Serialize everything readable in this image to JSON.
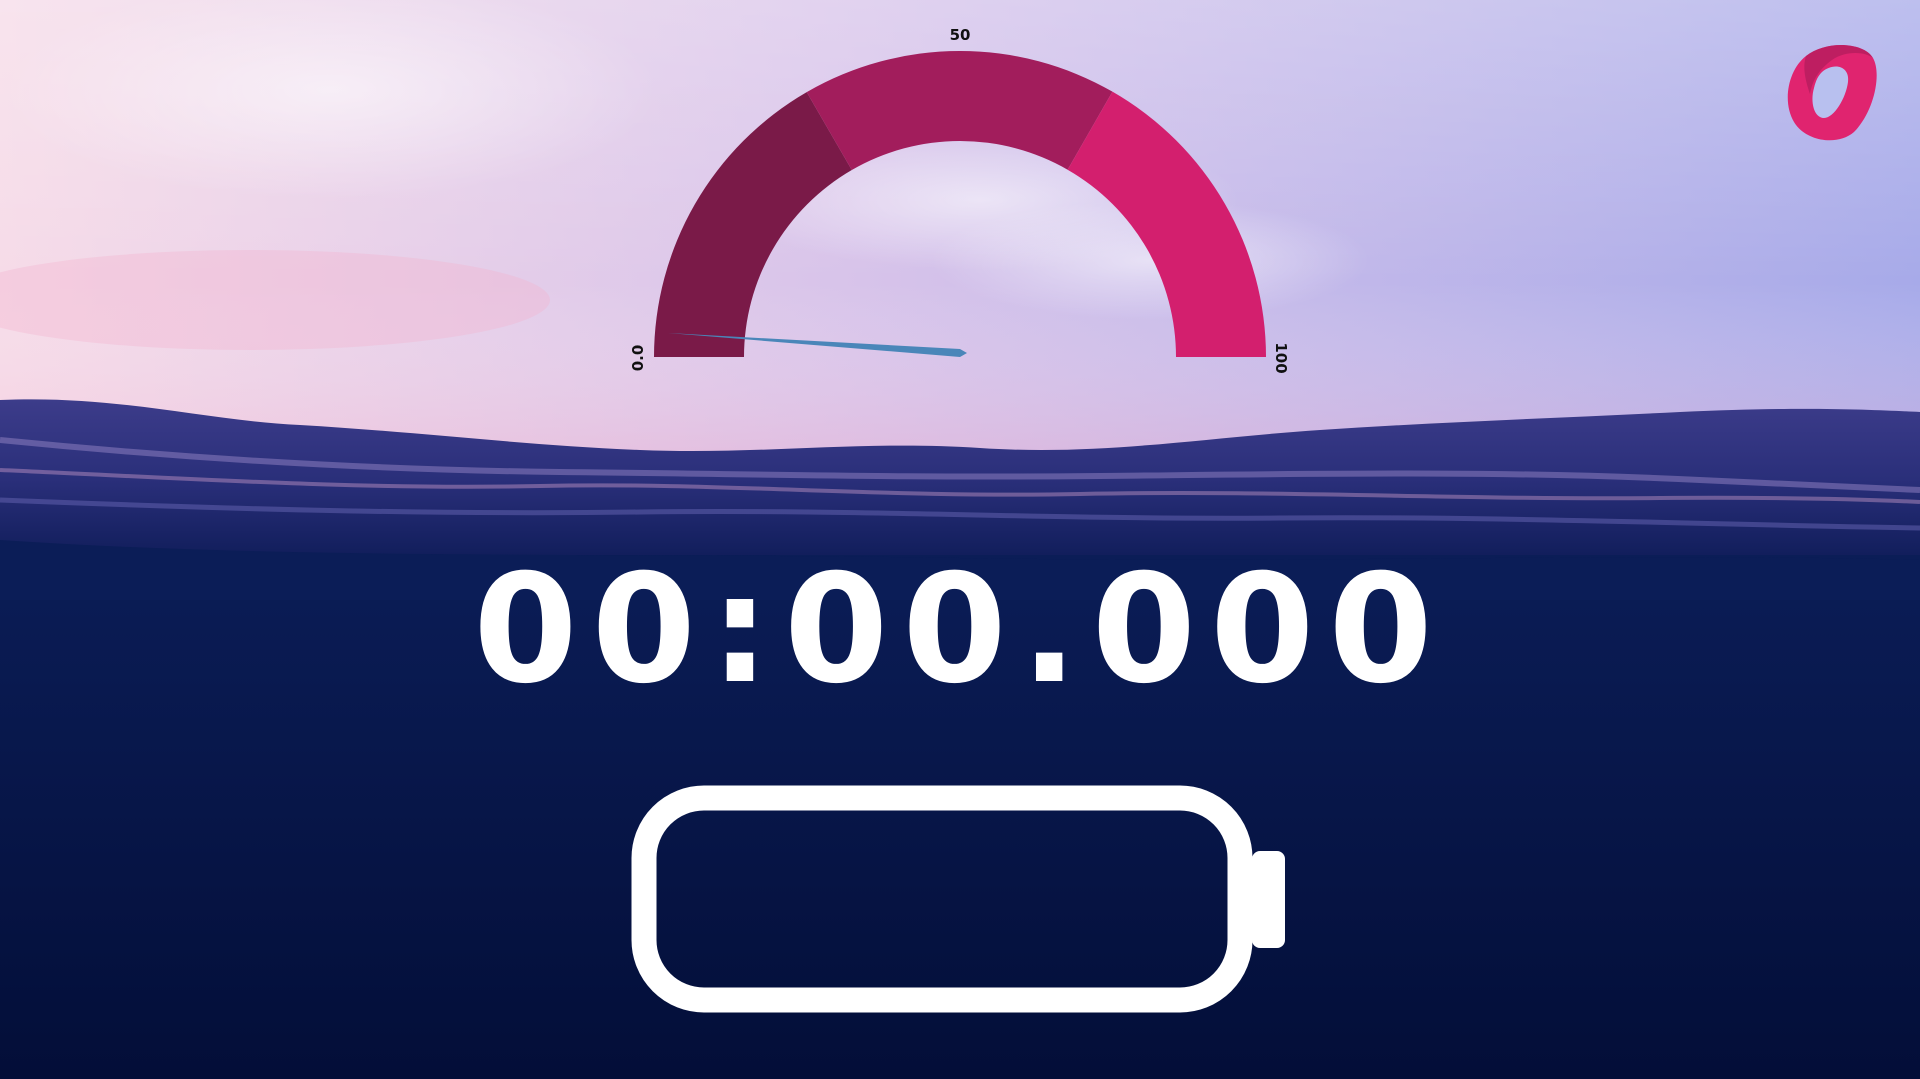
{
  "gauge": {
    "value": 0.0,
    "min_label": "0.0",
    "mid_label": "50",
    "max_label": "100",
    "segments": [
      {
        "from": 0,
        "to": 33.3,
        "color": "#7a1a48"
      },
      {
        "from": 33.3,
        "to": 66.6,
        "color": "#a21d5c"
      },
      {
        "from": 66.6,
        "to": 100,
        "color": "#d31f6e"
      }
    ],
    "needle_color": "#4a86b9"
  },
  "timer": {
    "display": "00:00.000"
  },
  "battery": {
    "level": 0,
    "color": "#ffffff"
  },
  "logo": {
    "icon": "brand-ring-logo",
    "color": "#e0246f"
  },
  "background": {
    "scene": "ocean-horizon",
    "sky_colors": [
      "#fbe8f0",
      "#c8b6e8",
      "#a9aae6"
    ],
    "water_color": "#06164a"
  }
}
